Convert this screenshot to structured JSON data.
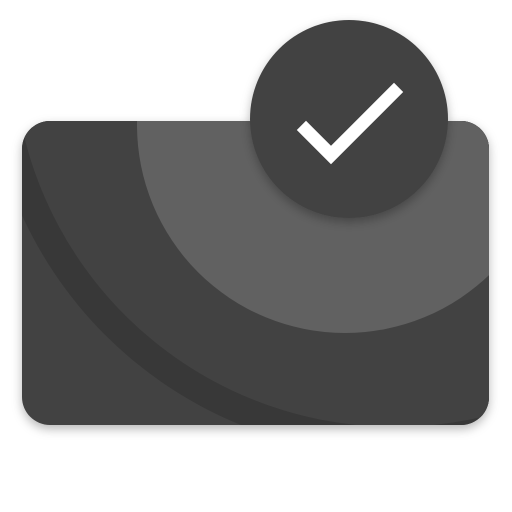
{
  "icon": {
    "name": "card-check-app-icon",
    "symbol": "check-mark-icon"
  },
  "colors": {
    "background": "#ffffff",
    "card_base": "#424242",
    "card_dark_arc": "#383838",
    "card_light_arc": "#616161",
    "badge": "#424242",
    "check_mark": "#ffffff"
  }
}
